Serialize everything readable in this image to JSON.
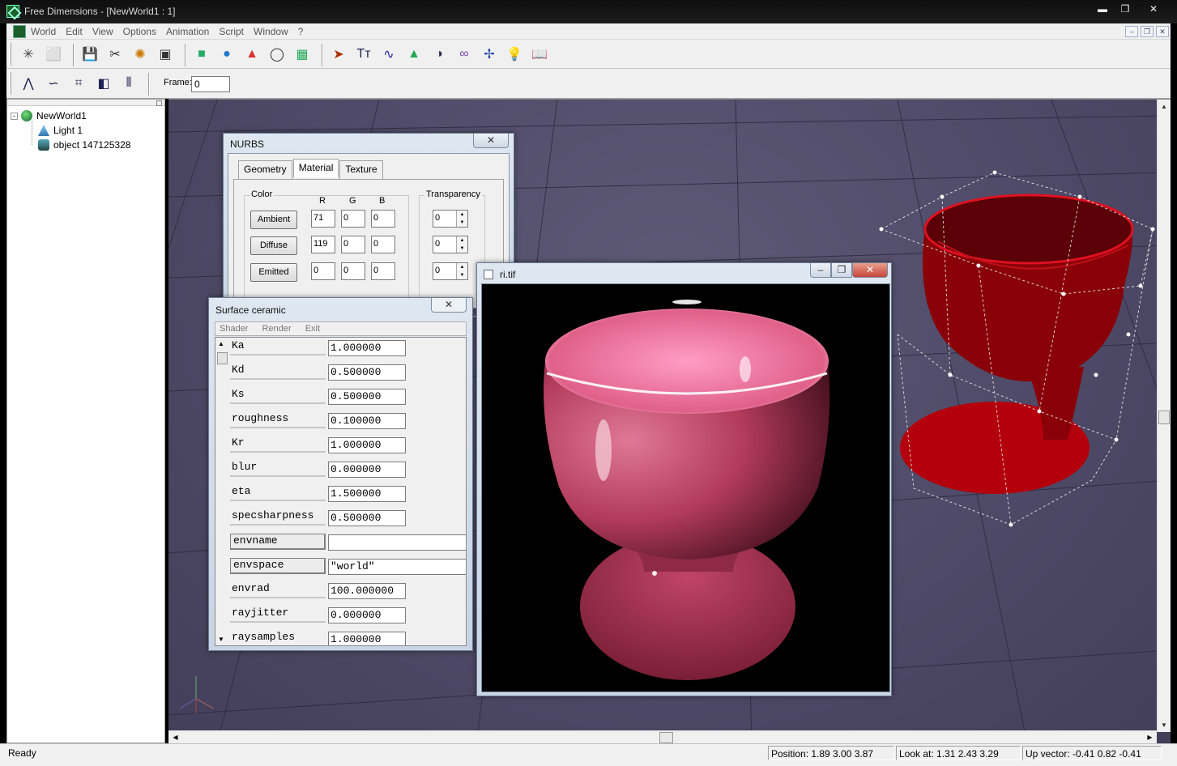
{
  "app": {
    "title": "Free Dimensions - [NewWorld1 : 1]",
    "window_buttons": [
      "▬",
      "❐",
      "✕"
    ],
    "mdi_buttons": [
      "–",
      "❐",
      "✕"
    ]
  },
  "menu": [
    "World",
    "Edit",
    "View",
    "Options",
    "Animation",
    "Script",
    "Window",
    "?"
  ],
  "toolbar": {
    "icons": [
      "wand-icon",
      "cube-icon",
      "save-icon",
      "scissors-icon",
      "explode-icon",
      "stamp-icon",
      "color-cube-icon",
      "sphere-icon",
      "cone-icon",
      "torus-icon",
      "grid-icon",
      "arrow-icon",
      "text-icon",
      "curve-icon",
      "mountain-icon",
      "sweep-icon",
      "infinity-icon",
      "axis-icon",
      "light-bulb-icon",
      "book-icon"
    ],
    "glyphs": [
      "✳",
      "⬜",
      "💾",
      "✂",
      "✺",
      "▣",
      "■",
      "●",
      "▲",
      "◯",
      "▦",
      "➤",
      "Tт",
      "∿",
      "▲",
      "◑",
      "∞",
      "✢",
      "💡",
      "📖"
    ],
    "colors": [
      "#444",
      "#333",
      "#225",
      "#333",
      "#c70",
      "#333",
      "#2a6",
      "#27c",
      "#d33",
      "#333",
      "#2a5",
      "#a30",
      "#225",
      "#229",
      "#2a5",
      "#335",
      "#74a",
      "#24a",
      "#dd2",
      "#333"
    ]
  },
  "toolbar2": {
    "icons": [
      "polyline-icon",
      "spline-icon",
      "patch-icon",
      "nurbs-face-icon",
      "revolve-icon"
    ],
    "glyphs": [
      "⋀",
      "∽",
      "⌗",
      "◧",
      "⦀"
    ],
    "frame_label": "Frame:",
    "frame_value": "0"
  },
  "tree": [
    {
      "label": "NewWorld1",
      "icon": "globe-icon",
      "expander": "-"
    },
    {
      "label": "Light 1",
      "icon": "light-icon"
    },
    {
      "label": "object 147125328",
      "icon": "object-icon"
    }
  ],
  "nurbs": {
    "title": "NURBS",
    "close": "✕",
    "tabs": [
      "Geometry",
      "Material",
      "Texture"
    ],
    "active_tab": "Material",
    "color_group": "Color",
    "transparency_group": "Transparency",
    "cols": [
      "R",
      "G",
      "B"
    ],
    "rows": [
      {
        "label": "Ambient",
        "r": "71",
        "g": "0",
        "b": "0",
        "t": "0"
      },
      {
        "label": "Diffuse",
        "r": "119",
        "g": "0",
        "b": "0",
        "t": "0"
      },
      {
        "label": "Emitted",
        "r": "0",
        "g": "0",
        "b": "0",
        "t": "0"
      }
    ]
  },
  "surface": {
    "title": "Surface ceramic",
    "close": "✕",
    "menu": [
      "Shader",
      "Render",
      "Exit"
    ],
    "params": [
      {
        "name": "Ka",
        "value": "1.000000",
        "button": false
      },
      {
        "name": "Kd",
        "value": "0.500000",
        "button": false
      },
      {
        "name": "Ks",
        "value": "0.500000",
        "button": false
      },
      {
        "name": "roughness",
        "value": "0.100000",
        "button": false
      },
      {
        "name": "Kr",
        "value": "1.000000",
        "button": false
      },
      {
        "name": "blur",
        "value": "0.000000",
        "button": false
      },
      {
        "name": "eta",
        "value": "1.500000",
        "button": false
      },
      {
        "name": "specsharpness",
        "value": "0.500000",
        "button": false
      },
      {
        "name": "envname",
        "value": "",
        "button": true
      },
      {
        "name": "envspace",
        "value": "\"world\"",
        "button": true
      },
      {
        "name": "envrad",
        "value": "100.000000",
        "button": false
      },
      {
        "name": "rayjitter",
        "value": "0.000000",
        "button": false
      },
      {
        "name": "raysamples",
        "value": "1.000000",
        "button": false
      }
    ]
  },
  "render_window": {
    "title": "ri.tif",
    "buttons": [
      "–",
      "❐",
      "✕"
    ]
  },
  "status": {
    "ready": "Ready",
    "position": "Position: 1.89 3.00 3.87",
    "lookat": "Look at: 1.31 2.43 3.29",
    "upvector": "Up vector: -0.41 0.82 -0.41"
  },
  "colors": {
    "viewport_bg": "#4f4b68",
    "cup_red": "#b00010",
    "render_pink": "#c8506e"
  }
}
